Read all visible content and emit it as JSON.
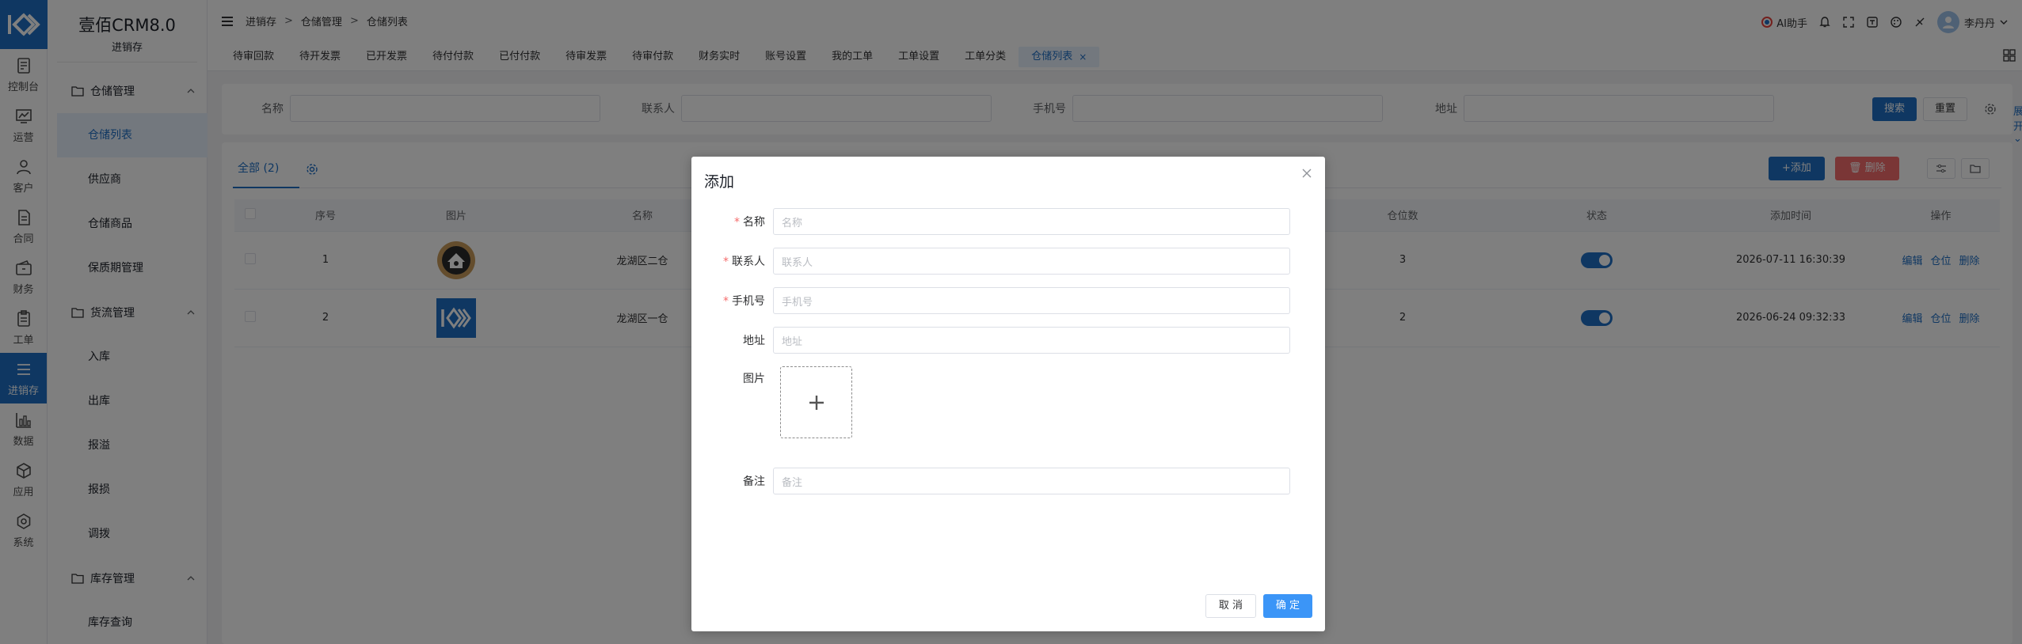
{
  "brand": {
    "name": "壹佰CRM8.0",
    "module": "进销存"
  },
  "rail": {
    "items": [
      {
        "label": "控制台",
        "icon": "dashboard-icon"
      },
      {
        "label": "运营",
        "icon": "chart-icon"
      },
      {
        "label": "客户",
        "icon": "user-icon"
      },
      {
        "label": "合同",
        "icon": "contract-icon"
      },
      {
        "label": "财务",
        "icon": "wallet-icon"
      },
      {
        "label": "工单",
        "icon": "clipboard-icon"
      },
      {
        "label": "进销存",
        "icon": "menu-icon"
      },
      {
        "label": "数据",
        "icon": "bar-chart-icon"
      },
      {
        "label": "应用",
        "icon": "cube-icon"
      },
      {
        "label": "系统",
        "icon": "settings-icon"
      }
    ],
    "active_index": 6
  },
  "sidebar": {
    "groups": [
      {
        "label": "仓储管理",
        "items": [
          "仓储列表",
          "供应商",
          "仓储商品",
          "保质期管理"
        ]
      },
      {
        "label": "货流管理",
        "items": [
          "入库",
          "出库",
          "报溢",
          "报损",
          "调拨"
        ]
      },
      {
        "label": "库存管理",
        "items": [
          "库存查询"
        ]
      }
    ],
    "active_item": "仓储列表"
  },
  "breadcrumb": [
    "进销存",
    "仓储管理",
    "仓储列表"
  ],
  "header_right": {
    "ai_label": "AI助手",
    "user_name": "李丹丹"
  },
  "tabs": [
    "待审回款",
    "待开发票",
    "已开发票",
    "待付付款",
    "已付付款",
    "待审发票",
    "待审付款",
    "财务实时",
    "账号设置",
    "我的工单",
    "工单设置",
    "工单分类",
    "仓储列表"
  ],
  "active_tab": "仓储列表",
  "filter": {
    "fields": [
      {
        "label": "名称"
      },
      {
        "label": "联系人"
      },
      {
        "label": "手机号"
      },
      {
        "label": "地址"
      }
    ],
    "expand_label": "展开",
    "search_label": "搜索",
    "reset_label": "重置"
  },
  "list": {
    "tab_label": "全部",
    "count": "(2)",
    "add_label": "+添加",
    "delete_label": "删除",
    "columns": [
      "序号",
      "图片",
      "名称",
      "",
      "",
      "仓位数",
      "状态",
      "添加时间",
      "操作"
    ],
    "rows": [
      {
        "index": "1",
        "name": "龙湖区二仓",
        "slots": "3",
        "enabled": true,
        "added": "2026-07-11 16:30:39"
      },
      {
        "index": "2",
        "name": "龙湖区一仓",
        "slots": "2",
        "enabled": true,
        "added": "2026-06-24 09:32:33"
      }
    ],
    "actions": [
      "编辑",
      "仓位",
      "删除"
    ]
  },
  "dialog": {
    "title": "添加",
    "fields": [
      {
        "label": "名称",
        "placeholder": "名称",
        "required": true
      },
      {
        "label": "联系人",
        "placeholder": "联系人",
        "required": true
      },
      {
        "label": "手机号",
        "placeholder": "手机号",
        "required": true
      },
      {
        "label": "地址",
        "placeholder": "地址",
        "required": false
      }
    ],
    "image_label": "图片",
    "remark": {
      "label": "备注",
      "placeholder": "备注"
    },
    "cancel_label": "取 消",
    "ok_label": "确 定"
  },
  "colors": {
    "accent": "#1f6fc5",
    "danger": "#f56c6c",
    "ok_button": "#3b95f7"
  }
}
